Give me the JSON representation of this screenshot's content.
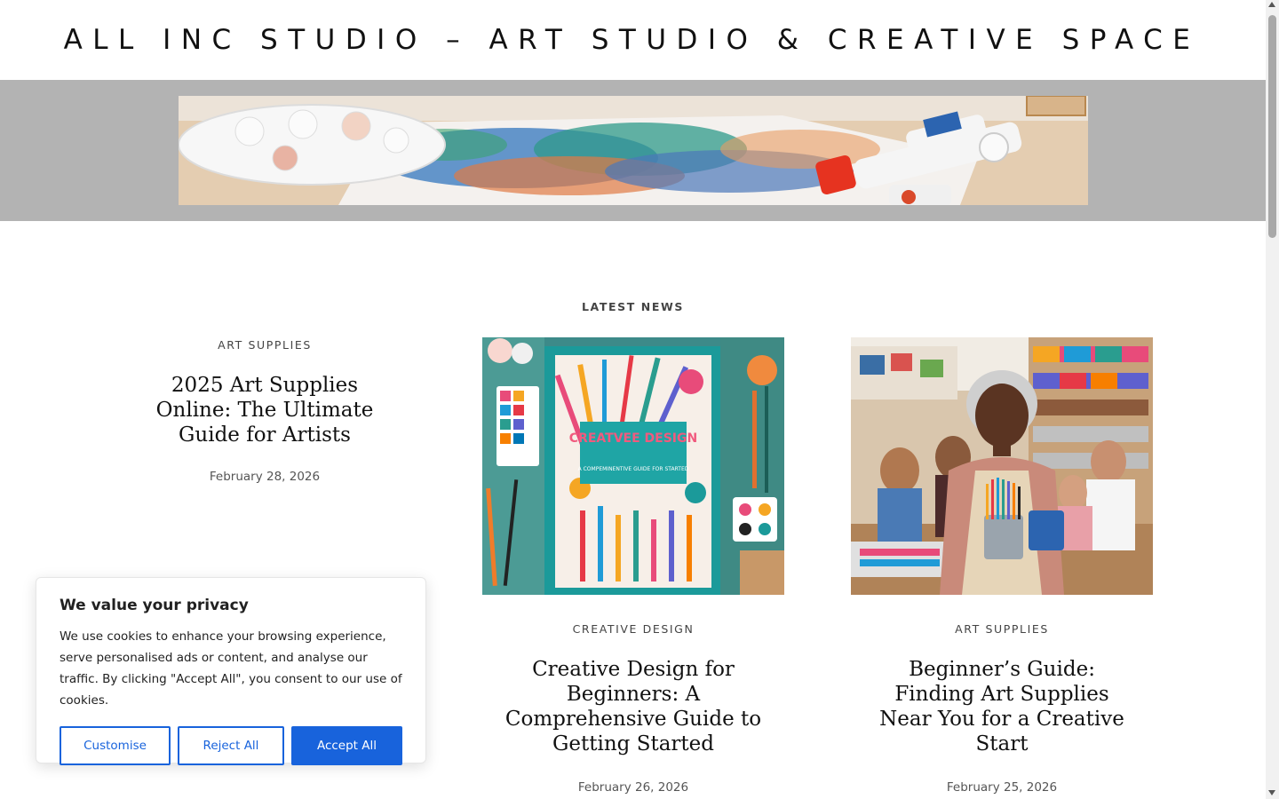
{
  "site": {
    "title": "ALL INC STUDIO – ART STUDIO & CREATIVE SPACE"
  },
  "section": {
    "label": "LATEST NEWS"
  },
  "posts": [
    {
      "category": "ART SUPPLIES",
      "title": "2025 Art Supplies Online: The Ultimate Guide for Artists",
      "date": "February 28, 2026"
    },
    {
      "category": "CREATIVE DESIGN",
      "title": "Creative Design for Beginners: A Comprehensive Guide to Getting Started",
      "date": "February 26, 2026",
      "image_text_main": "CREATVEE DESIGN",
      "image_text_sub": "A COMPEMINENTIVE GUIDE FOR STARTED"
    },
    {
      "category": "ART SUPPLIES",
      "title": "Beginner’s Guide: Finding Art Supplies Near You for a Creative Start",
      "date": "February 25, 2026"
    }
  ],
  "cookie_banner": {
    "heading": "We value your privacy",
    "text": "We use cookies to enhance your browsing experience, serve personalised ads or content, and analyse our traffic. By clicking \"Accept All\", you consent to our use of cookies.",
    "customise_label": "Customise",
    "reject_label": "Reject All",
    "accept_label": "Accept All"
  },
  "colors": {
    "accent": "#1863dc",
    "hero_band": "#b3b3b3"
  }
}
